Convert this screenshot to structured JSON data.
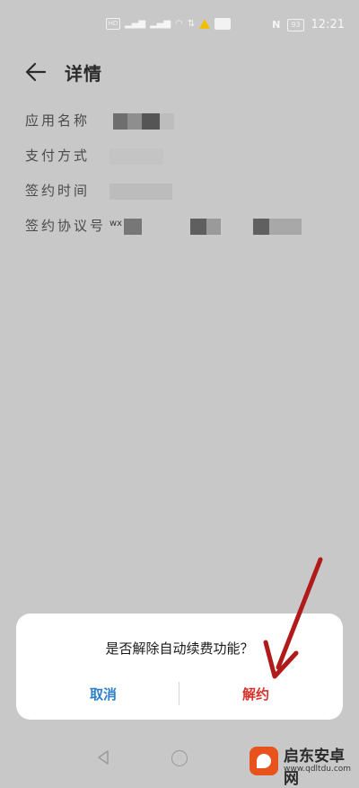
{
  "status_bar": {
    "icons": [
      "hd-icon",
      "signal-icon",
      "signal-icon",
      "wifi-icon",
      "upload-icon",
      "warning-icon",
      "app-badge-icon"
    ],
    "hd_label": "HD",
    "nfc": "N",
    "battery": "93",
    "time": "12:21"
  },
  "header": {
    "title": "详情"
  },
  "details": {
    "rows": [
      {
        "label": "应用名称"
      },
      {
        "label": "支付方式"
      },
      {
        "label": "签约时间"
      },
      {
        "label": "签约协议号",
        "prefix": "wx"
      }
    ]
  },
  "dialog": {
    "message": "是否解除自动续费功能？",
    "cancel_label": "取消",
    "confirm_label": "解约",
    "colors": {
      "cancel": "#2d7fc8",
      "confirm": "#d9322b"
    }
  },
  "watermark": {
    "name": "启东安卓网",
    "url": "www.qdltdu.com"
  }
}
